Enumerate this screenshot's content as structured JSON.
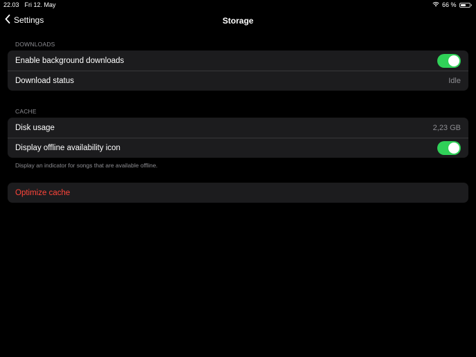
{
  "status_bar": {
    "time": "22.03",
    "date": "Fri 12. May",
    "battery": "66 %",
    "battery_level": 0.66
  },
  "nav": {
    "back_label": "Settings",
    "title": "Storage"
  },
  "downloads": {
    "header": "DOWNLOADS",
    "rows": [
      {
        "label": "Enable background downloads",
        "toggle_on": true
      },
      {
        "label": "Download status",
        "value": "Idle"
      }
    ]
  },
  "cache": {
    "header": "CACHE",
    "rows": [
      {
        "label": "Disk usage",
        "value": "2,23 GB"
      },
      {
        "label": "Display offline availability icon",
        "toggle_on": true
      }
    ],
    "footer": "Display an indicator for songs that are available offline."
  },
  "actions": {
    "optimize_label": "Optimize cache"
  },
  "colors": {
    "accent_green": "#30d158",
    "danger_red": "#ff453a",
    "group_bg": "#1c1c1e",
    "secondary_text": "#8e8e93"
  }
}
